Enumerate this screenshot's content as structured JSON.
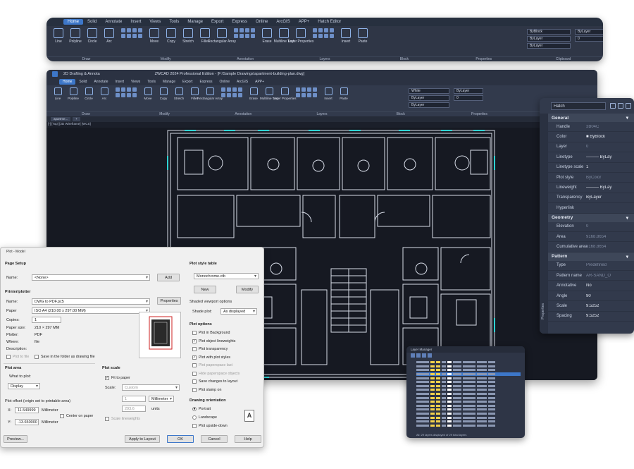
{
  "ribbon_float": {
    "tabs": [
      "Home",
      "Solid",
      "Annotate",
      "Insert",
      "Views",
      "Tools",
      "Manage",
      "Export",
      "Express",
      "Online",
      "ArcGIS",
      "APP+",
      "Hatch Editor"
    ],
    "active_tab": "Home",
    "tools": [
      "Line",
      "Polyline",
      "Circle",
      "Arc",
      "Move",
      "Copy",
      "Stretch",
      "Fillet",
      "Rectangular Array",
      "Erase",
      "Multiline Text",
      "Layer Properties",
      "Insert",
      "Paste"
    ],
    "combos": {
      "color": "ByBlock",
      "linetype": "ByLayer",
      "lineweight": "ByLayer",
      "linetype2": "ByLayer",
      "plotstyle": "0"
    },
    "groups": [
      "Draw",
      "Modify",
      "Annotation",
      "Layers",
      "Block",
      "Properties",
      "Clipboard"
    ]
  },
  "main_window": {
    "app_tab": "2D Drafting & Annota",
    "title": "ZWCAD 2024 Professional Edition - [F:\\Sample Drawings\\apartment-building-plan.dwg]",
    "tabs": [
      "Home",
      "Solid",
      "Annotate",
      "Insert",
      "Views",
      "Tools",
      "Manage",
      "Export",
      "Express",
      "Online",
      "ArcGIS",
      "APP+"
    ],
    "active_tab": "Home",
    "tools": [
      "Line",
      "Polyline",
      "Circle",
      "Arc",
      "Move",
      "Copy",
      "Stretch",
      "Fillet",
      "Rectangular Array",
      "Erase",
      "Multiline Text",
      "Layer Properties",
      "Insert",
      "Paste"
    ],
    "combos": {
      "color": "White",
      "linetype": "ByLayer",
      "lineweight": "ByLayer",
      "plotstyle": "0"
    },
    "groups": [
      "Draw",
      "Modify",
      "Annotation",
      "Layers",
      "Block",
      "Properties",
      "Clipboard"
    ],
    "file_tabs": [
      "apartme...",
      "+"
    ],
    "viewport_label": "[-] [Top] [2D Wireframe] [WCS]"
  },
  "properties": {
    "object": "Hatch",
    "side_label": "Properties",
    "sections": [
      {
        "name": "General",
        "rows": [
          {
            "k": "Handle",
            "v": "3B04C"
          },
          {
            "k": "Color",
            "v": "■ ByBlock"
          },
          {
            "k": "Layer",
            "v": "0"
          },
          {
            "k": "Linetype",
            "v": "——— ByLay"
          },
          {
            "k": "Linetype scale",
            "v": "1"
          },
          {
            "k": "Plot style",
            "v": "ByColor"
          },
          {
            "k": "Lineweight",
            "v": "——— ByLay"
          },
          {
            "k": "Transparency",
            "v": "ByLayer"
          },
          {
            "k": "Hyperlink",
            "v": ""
          }
        ]
      },
      {
        "name": "Geometry",
        "rows": [
          {
            "k": "Elevation",
            "v": "0"
          },
          {
            "k": "Area",
            "v": "9168.8654"
          },
          {
            "k": "Cumulative area",
            "v": "9168.8654"
          }
        ]
      },
      {
        "name": "Pattern",
        "rows": [
          {
            "k": "Type",
            "v": "Predefined"
          },
          {
            "k": "Pattern name",
            "v": "AR-SAND_O"
          },
          {
            "k": "Annotative",
            "v": "No"
          },
          {
            "k": "Angle",
            "v": "90"
          },
          {
            "k": "Scale",
            "v": "9.5252"
          },
          {
            "k": "Spacing",
            "v": "9.5252"
          }
        ]
      }
    ]
  },
  "layer_manager": {
    "title": "Layer Manager",
    "side_label": "Layer Manager",
    "status": "All: 29 layers displayed of 29 total layers"
  },
  "plot": {
    "title": "Plot - Model",
    "page_setup": {
      "header": "Page Setup",
      "name_label": "Name:",
      "name_value": "<None>",
      "add": "Add"
    },
    "printer": {
      "header": "Printer/plotter",
      "name_label": "Name:",
      "name_value": "DWG to PDF.pc5",
      "properties": "Properties",
      "paper_label": "Paper",
      "paper_value": "ISO A4 (210.00 x 297.00 MM)",
      "copies_label": "Copies:",
      "copies_value": "1",
      "paper_size_label": "Paper size:",
      "paper_size_value": "210 × 297 MM",
      "plotter_label": "Plotter:",
      "plotter_value": "PDF",
      "where_label": "Where:",
      "where_value": "file",
      "description_label": "Description:",
      "plot_to_file": "Plot to file",
      "save_folder": "Save in the folder as drawing file"
    },
    "plot_area": {
      "header": "Plot area",
      "what_label": "What to plot:",
      "what_value": "Display"
    },
    "plot_offset": {
      "header": "Plot offset (origin set to printable area)",
      "x_label": "X:",
      "x_value": "11.549999",
      "y_label": "Y:",
      "y_value": "-13.650000",
      "unit": "Millimeter",
      "center": "Center on paper"
    },
    "plot_scale": {
      "header": "Plot scale",
      "fit": "Fit to paper",
      "scale_label": "Scale:",
      "scale_value": "Custom",
      "v1": "1",
      "unit1": "Millimeter",
      "v2": "293.6",
      "unit2": "units",
      "lineweights": "Scale lineweights"
    },
    "style_table": {
      "header": "Plot style table",
      "value": "Monochrome.ctb",
      "new": "New",
      "modify": "Modify"
    },
    "shaded": {
      "header": "Shaded viewport options",
      "label": "Shade plot:",
      "value": "As displayed"
    },
    "options": {
      "header": "Plot options",
      "items": [
        {
          "label": "Plot in Background",
          "checked": false,
          "dim": false
        },
        {
          "label": "Plot object lineweights",
          "checked": true,
          "dim": false
        },
        {
          "label": "Plot transparency",
          "checked": false,
          "dim": false
        },
        {
          "label": "Plot with plot styles",
          "checked": true,
          "dim": false
        },
        {
          "label": "Plot paperspace last",
          "checked": false,
          "dim": true
        },
        {
          "label": "Hide paperspace objects",
          "checked": false,
          "dim": true
        },
        {
          "label": "Save changes to layout",
          "checked": false,
          "dim": false
        },
        {
          "label": "Plot stamp on",
          "checked": false,
          "dim": false
        }
      ]
    },
    "orientation": {
      "header": "Drawing orientation",
      "portrait": "Portrait",
      "landscape": "Landscape",
      "upside": "Plot upside-down",
      "icon": "A"
    },
    "buttons": {
      "preview": "Preview...",
      "apply": "Apply to Layout",
      "ok": "OK",
      "cancel": "Cancel",
      "help": "Help"
    }
  }
}
